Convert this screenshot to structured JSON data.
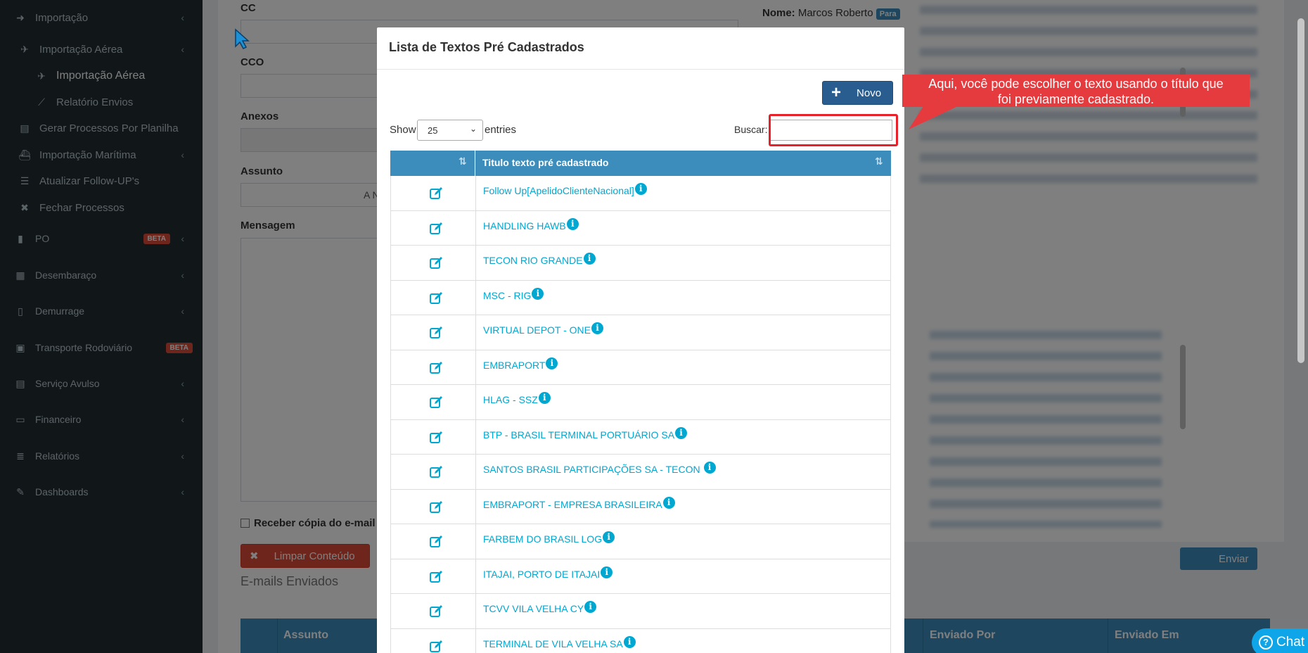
{
  "sidebar": {
    "items": [
      {
        "label": "Importação",
        "icon": "arrow-circle-icon"
      },
      {
        "label": "Importação Aérea",
        "icon": "plane-icon"
      },
      {
        "label": "Importação Aérea",
        "icon": "plane-icon"
      },
      {
        "label": "Relatório Envios",
        "icon": "line-chart-icon"
      },
      {
        "label": "Gerar Processos Por Planilha",
        "icon": "file-excel-icon"
      },
      {
        "label": "Importação Marítima",
        "icon": "ship-icon"
      },
      {
        "label": "Atualizar Follow-UP's",
        "icon": "list-icon"
      },
      {
        "label": "Fechar Processos",
        "icon": "close-icon"
      },
      {
        "label": "PO",
        "icon": "bar-chart-icon",
        "badge": "BETA"
      },
      {
        "label": "Desembaraço",
        "icon": "table-icon"
      },
      {
        "label": "Demurrage",
        "icon": "file-icon"
      },
      {
        "label": "Transporte Rodoviário",
        "icon": "bus-icon",
        "badge": "BETA"
      },
      {
        "label": "Serviço Avulso",
        "icon": "file-text-icon"
      },
      {
        "label": "Financeiro",
        "icon": "money-icon"
      },
      {
        "label": "Relatórios",
        "icon": "database-icon"
      },
      {
        "label": "Dashboards",
        "icon": "edit-icon"
      }
    ]
  },
  "form": {
    "cc_label": "CC",
    "cco_label": "CCO",
    "anexos_label": "Anexos",
    "assunto_label": "Assunto",
    "assunto_fragment": "A N",
    "mensagem_label": "Mensagem",
    "copy_checkbox_label": "Receber cópia do e-mail",
    "clear_button": "Limpar Conteúdo",
    "send_button": "Enviar",
    "sent_emails_title": "E-mails Enviados",
    "sent_table_headers": [
      "Assunto",
      "Enviado Por",
      "Enviado Em"
    ],
    "recipient_label": "Nome:",
    "recipient_name": "Marcos Roberto",
    "recipient_badge": "Para"
  },
  "modal": {
    "title": "Lista de Textos Pré Cadastrados",
    "new_button": "Novo",
    "show_label": "Show",
    "entries_label": "entries",
    "page_length": "25",
    "search_label": "Buscar:",
    "search_value": "",
    "column_header": "Titulo texto pré cadastrado",
    "rows": [
      "Follow Up[ApelidoClienteNacional]",
      "HANDLING HAWB",
      "TECON RIO GRANDE",
      "MSC - RIG",
      "VIRTUAL DEPOT - ONE",
      "EMBRAPORT",
      "HLAG - SSZ",
      "BTP - BRASIL TERMINAL PORTUÁRIO SA",
      "SANTOS BRASIL PARTICIPAÇÕES SA - TECON ",
      "EMBRAPORT - EMPRESA BRASILEIRA",
      "FARBEM DO BRASIL LOG",
      "ITAJAI, PORTO DE ITAJAI",
      "TCVV VILA VELHA CY",
      "TERMINAL DE VILA VELHA SA"
    ]
  },
  "callout": {
    "line1": "Aqui, você pode escolher o texto usando o título que",
    "line2": "foi previamente cadastrado."
  },
  "chat": {
    "label": "Chat"
  },
  "colors": {
    "sidebar_bg": "#222d32",
    "header_blue": "#3c8dbc",
    "link_cyan": "#00a7d0",
    "callout_red": "#e63b3e",
    "novo_button": "#2a5d8f"
  }
}
